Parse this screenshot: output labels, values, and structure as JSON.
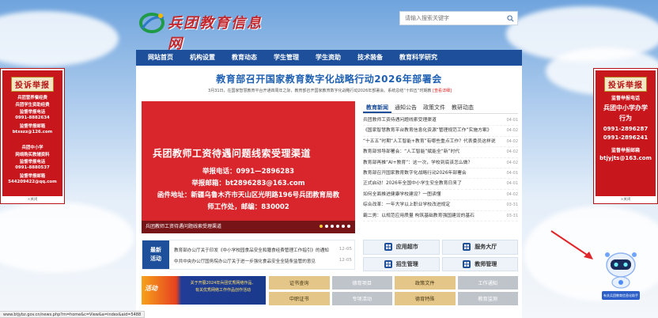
{
  "header": {
    "logo_text": "兵团教育信息网",
    "search_placeholder": "请输入搜索关键字"
  },
  "nav": {
    "items": [
      "网站首页",
      "机构设置",
      "教育动态",
      "学生管理",
      "学生资助",
      "技术装备",
      "教育科学研究"
    ]
  },
  "headline": {
    "title": "教育部召开国家教育数字化战略行动2026年部署会",
    "summary": "3月31日，在国家智慧教育平台开通四周年之际，教育部召开国家教育数字化战略行动2026年部署会。系统总结“十四五”时期教",
    "detail_link": "[查看详细]"
  },
  "slideshow": {
    "title": "兵团教师工资待遇问题线索受理渠道",
    "phone": "举报电话：0991—2896283",
    "email": "举报邮箱：bt2896283@163.com",
    "address_1": "函件地址：新疆乌鲁木齐市天山区光明路196号兵团教育局教",
    "address_2": "师工作处，邮编：830002",
    "caption": "兵团教师工资待遇问题线索受理渠道",
    "slide_count": 6,
    "active_slide": 1
  },
  "news": {
    "tabs": [
      "教育新闻",
      "通知公告",
      "政策文件",
      "教研动态"
    ],
    "active_tab": 0,
    "items": [
      {
        "title": "兵团教师工资待遇问题线索受理渠道",
        "date": "04-01"
      },
      {
        "title": "《国家智慧教育平台教育信息化资源“管理规范工作”实施方案》",
        "date": "04-02"
      },
      {
        "title": "“十五五”时期“人工智能+教育”有哪些重点工作？代表委员这样说",
        "date": "04-02"
      },
      {
        "title": "教育部领导部署会：“人工智能”赋能全“新”时代",
        "date": "04-02"
      },
      {
        "title": "教育部再推“AI+教育”：这一次，学校到底该怎么做？",
        "date": "04-02"
      },
      {
        "title": "教育部召开国家教育数字化战略行动2026年部署会",
        "date": "04-01"
      },
      {
        "title": "正式启动！2026年全国中小学生安全教育日来了",
        "date": "04-01"
      },
      {
        "title": "如何全面推进健康学校建设？一图读懂",
        "date": "04-02"
      },
      {
        "title": "综合改革：一年大学以上职业学校改进规定",
        "date": "03-31"
      },
      {
        "title": "霸二男：以规范应用质量 构筑基础教育强国建设的基石",
        "date": "03-31"
      }
    ]
  },
  "latest": {
    "badge": "最新活动",
    "badge_line1": "最新",
    "badge_line2": "活动",
    "items": [
      {
        "title": "教育部办公厅关于印发《中小学校园食品安全和膳食经费管理工作指引》的通知",
        "date": "12-05"
      },
      {
        "title": "中共中央办公厅国务院办公厅关于进一步强化食品安全全链条监管的意见",
        "date": "12-05"
      }
    ]
  },
  "quick_links": [
    "应用超市",
    "服务大厅",
    "招生管理",
    "教师管理"
  ],
  "banner": {
    "left": "活动",
    "right_line1": "关于开展2024年兵团优秀网络作品、",
    "right_line2": "有关优秀网络工作作品创作活动"
  },
  "tiles": [
    "证书查询",
    "德育项目",
    "政策文件",
    "工作通知",
    "中职证书",
    "专项活动",
    "德育特殊",
    "教育监测"
  ],
  "left_ad": {
    "title": "投诉举报",
    "lines": [
      "兵团营养餐经费",
      "兵团学生资助经费",
      "监督举报电话",
      "0991-8882634",
      "监督举报邮箱",
      "btxszz@126.com",
      "",
      "兵团中小学",
      "网络购买教辅资料",
      "监督举报电话",
      "0991-8880537",
      "监督举报邮箱",
      "544209422@qq.com"
    ],
    "close": "×关闭"
  },
  "right_ad": {
    "title": "投诉举报",
    "lines": [
      "监督举报电话",
      "兵团中小学办学",
      "行为",
      "0991-2896287",
      "0991-2896241",
      "监督举报邮箱",
      "btjyjts@163.com"
    ],
    "close": "×关闭"
  },
  "robot": {
    "label": "有关兵团教育信息化助手"
  },
  "status_bar": {
    "url": "www.btjybz.gov.cn/news.php?m=home&c=View&a=index&aid=5488"
  },
  "colors": {
    "nav": "#1d4f9a",
    "slide": "#d9262c",
    "ad_red": "#c8161d",
    "headline": "#1d5fb2"
  }
}
